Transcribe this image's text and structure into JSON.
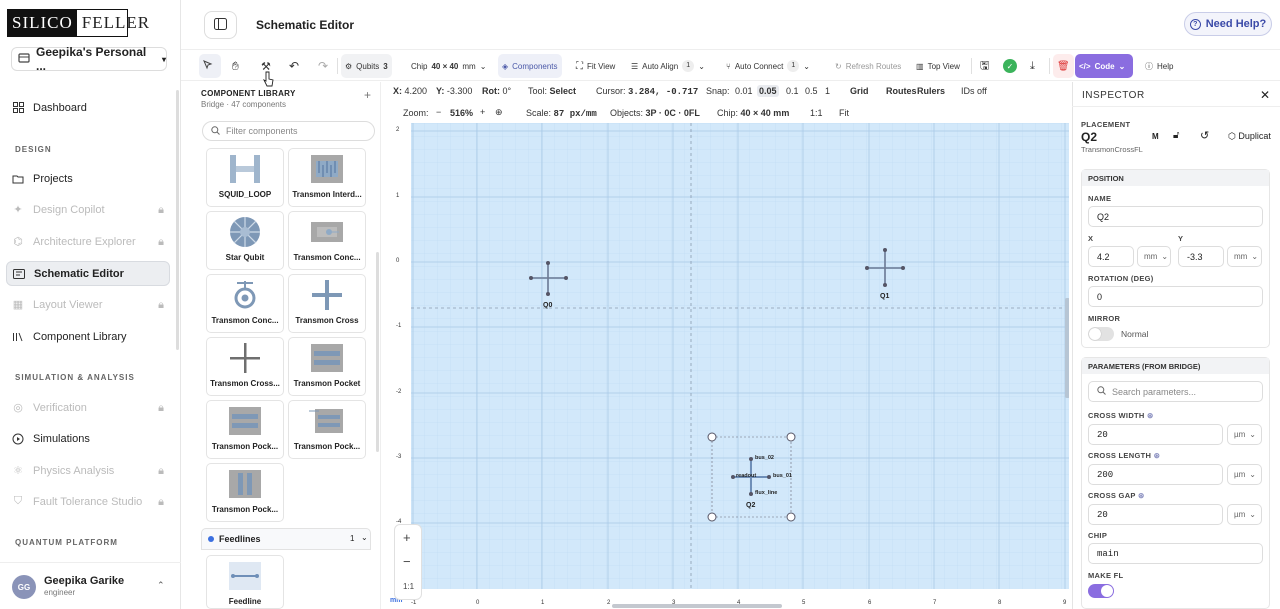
{
  "brand": {
    "part1": "SILICO",
    "part2": "FELLER"
  },
  "workspace": {
    "name": "Geepika's Personal ..."
  },
  "nav": {
    "dashboard": "Dashboard",
    "section_design": "DESIGN",
    "projects": "Projects",
    "design_copilot": "Design Copilot",
    "architecture_explorer": "Architecture Explorer",
    "schematic_editor": "Schematic Editor",
    "layout_viewer": "Layout Viewer",
    "component_library": "Component Library",
    "section_sim": "SIMULATION & ANALYSIS",
    "verification": "Verification",
    "simulations": "Simulations",
    "physics_analysis": "Physics Analysis",
    "fault_tolerance": "Fault Tolerance Studio",
    "section_quantum": "QUANTUM PLATFORM"
  },
  "user": {
    "initials": "GG",
    "name": "Geepika Garike",
    "role": "engineer"
  },
  "header": {
    "title": "Schematic Editor",
    "help": "Need Help?"
  },
  "toolbar": {
    "qubits_label": "Qubits",
    "qubits_count": "3",
    "chip_label": "Chip",
    "chip_size": "40 × 40",
    "chip_unit": "mm",
    "components": "Components",
    "fit_view": "Fit View",
    "auto_align": "Auto Align",
    "auto_align_count": "1",
    "auto_connect": "Auto Connect",
    "auto_connect_count": "1",
    "refresh_routes": "Refresh Routes",
    "top_view": "Top View",
    "code": "Code",
    "help": "Help"
  },
  "library": {
    "title": "COMPONENT LIBRARY",
    "subtitle": "Bridge · 47 components",
    "filter_placeholder": "Filter components",
    "items": [
      "SQUID_LOOP",
      "Transmon Interd...",
      "Star Qubit",
      "Transmon Conc...",
      "Transmon Conc...",
      "Transmon Cross",
      "Transmon Cross...",
      "Transmon Pocket",
      "Transmon Pock...",
      "Transmon Pock...",
      "Transmon Pock..."
    ],
    "feedlines": {
      "label": "Feedlines",
      "count": "1",
      "item": "Feedline"
    }
  },
  "status": {
    "x_label": "X:",
    "x": "4.200",
    "y_label": "Y:",
    "y": "-3.300",
    "rot_label": "Rot:",
    "rot": "0°",
    "tool_label": "Tool:",
    "tool": "Select",
    "cursor_label": "Cursor:",
    "cursor": "3.284, -0.717",
    "snap_label": "Snap:",
    "snaps": [
      "0.01",
      "0.05",
      "0.1",
      "0.5",
      "1"
    ],
    "grid": "Grid",
    "routes": "Routes",
    "rulers": "Rulers",
    "ids_off": "IDs off",
    "zoom_label": "Zoom:",
    "zoom_minus": "−",
    "zoom": "516%",
    "zoom_plus": "+",
    "scale_label": "Scale:",
    "scale": "87 px/mm",
    "objects_label": "Objects:",
    "objects": "3P · 0C · 0FL",
    "chip_label": "Chip:",
    "chip": "40 × 40 mm",
    "one_to_one": "1:1",
    "fit": "Fit"
  },
  "canvas": {
    "y_ticks": [
      "2",
      "1",
      "0",
      "-1",
      "-2",
      "-3",
      "-4"
    ],
    "x_ticks": [
      "-1",
      "0",
      "1",
      "2",
      "3",
      "4",
      "5",
      "6",
      "7",
      "8",
      "9"
    ],
    "qubits": [
      {
        "name": "Q0"
      },
      {
        "name": "Q1"
      },
      {
        "name": "Q2"
      }
    ],
    "pins": [
      "bus_02",
      "readout",
      "bus_01",
      "flux_line"
    ],
    "zoom_in": "+",
    "zoom_out": "−",
    "zoom_reset": "1:1",
    "mm_label": "mm"
  },
  "inspector": {
    "title": "INSPECTOR",
    "placement_label": "PLACEMENT",
    "name": "Q2",
    "m_tag": "M",
    "duplicate": "Duplicat",
    "class_name": "TransmonCrossFL",
    "position_header": "POSITION",
    "name_label": "NAME",
    "name_value": "Q2",
    "x_label": "X",
    "x_value": "4.2",
    "x_unit": "mm",
    "y_label": "Y",
    "y_value": "-3.3",
    "y_unit": "mm",
    "rotation_label": "ROTATION (DEG)",
    "rotation_value": "0",
    "mirror_label": "MIRROR",
    "mirror_value": "Normal",
    "params_header": "PARAMETERS (FROM BRIDGE)",
    "params_placeholder": "Search parameters...",
    "cross_width_label": "CROSS WIDTH",
    "cross_width": "20",
    "cross_width_unit": "µm",
    "cross_length_label": "CROSS LENGTH",
    "cross_length": "200",
    "cross_length_unit": "µm",
    "cross_gap_label": "CROSS GAP",
    "cross_gap": "20",
    "cross_gap_unit": "µm",
    "chip_label": "CHIP",
    "chip_value": "main",
    "make_fl_label": "MAKE FL"
  },
  "colors": {
    "accent": "#8a6de0",
    "canvas_bg": "#d2e8fa",
    "help_text": "#3b4aa8"
  }
}
